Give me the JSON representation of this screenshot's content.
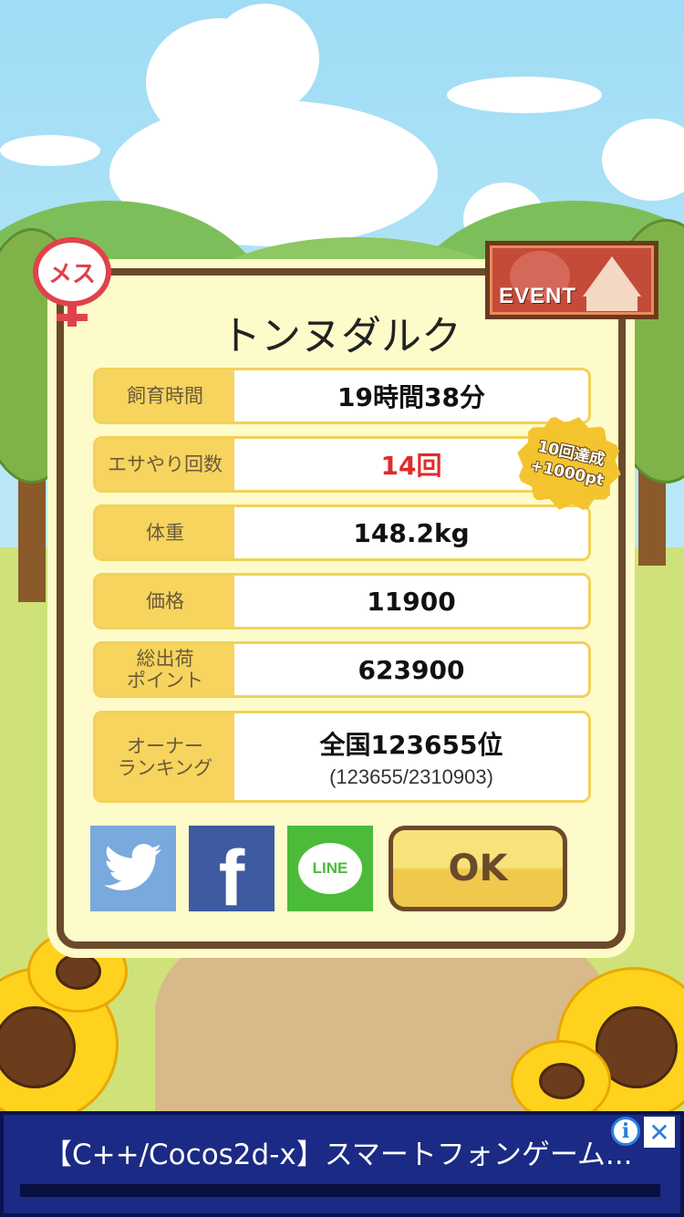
{
  "pig": {
    "name": "トンヌダルク",
    "gender_label": "メス"
  },
  "event_badge": {
    "label": "EVENT"
  },
  "stats": [
    {
      "label": "飼育時間",
      "value": "19時間38分"
    },
    {
      "label": "エサやり回数",
      "value": "14回",
      "value_color": "#e02b2b"
    },
    {
      "label": "体重",
      "value": "148.2kg"
    },
    {
      "label": "価格",
      "value": "11900"
    },
    {
      "label": "総出荷\nポイント",
      "value": "623900"
    },
    {
      "label": "オーナー\nランキング",
      "value": "全国123655位",
      "sub": "(123655/2310903)"
    }
  ],
  "bonus_badge": {
    "line1": "10回達成",
    "line2": "+1000pt"
  },
  "share": [
    {
      "service": "twitter",
      "icon": "twitter-bird-icon"
    },
    {
      "service": "facebook",
      "icon": "facebook-f-icon",
      "glyph": "f"
    },
    {
      "service": "line",
      "icon": "line-logo-icon",
      "glyph": "LINE"
    }
  ],
  "ok_label": "OK",
  "ad": {
    "text": "【C++/Cocos2d-x】スマートフォンゲーム...",
    "info_icon": "info-icon",
    "close_icon": "close-icon"
  },
  "colors": {
    "panel_bg": "#fdfbc9",
    "panel_border": "#6b4a2b",
    "label_bg": "#f6d45e",
    "accent_red": "#e02b2b",
    "ad_bg": "#1b2a84"
  }
}
